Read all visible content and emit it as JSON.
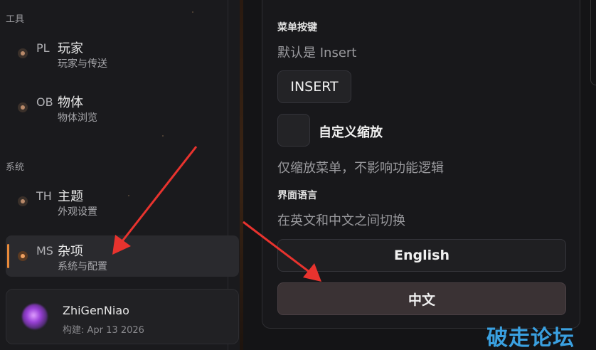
{
  "sidebar": {
    "sections": [
      {
        "label": "工具",
        "items": [
          {
            "code": "PL",
            "title": "玩家",
            "subtitle": "玩家与传送"
          },
          {
            "code": "OB",
            "title": "物体",
            "subtitle": "物体浏览"
          }
        ]
      },
      {
        "label": "系统",
        "items": [
          {
            "code": "TH",
            "title": "主题",
            "subtitle": "外观设置"
          },
          {
            "code": "MS",
            "title": "杂项",
            "subtitle": "系统与配置",
            "active": true
          }
        ]
      }
    ],
    "user": {
      "name": "ZhiGenNiao",
      "build_label": "构建:",
      "build_date": "Apr 13 2026"
    }
  },
  "settings": {
    "menu_key": {
      "label": "菜单按键",
      "hint": "默认是 Insert",
      "key_value": "INSERT"
    },
    "custom_scale": {
      "label": "自定义缩放",
      "hint": "仅缩放菜单，不影响功能逻辑",
      "checked": false
    },
    "language": {
      "label": "界面语言",
      "hint": "在英文和中文之间切换",
      "options": [
        "English",
        "中文"
      ],
      "selected": "中文"
    }
  },
  "watermark": "破走论坛",
  "colors": {
    "accent": "#e98a3a",
    "annotation_arrow": "#e8332e",
    "watermark": "#3aa0e0"
  }
}
